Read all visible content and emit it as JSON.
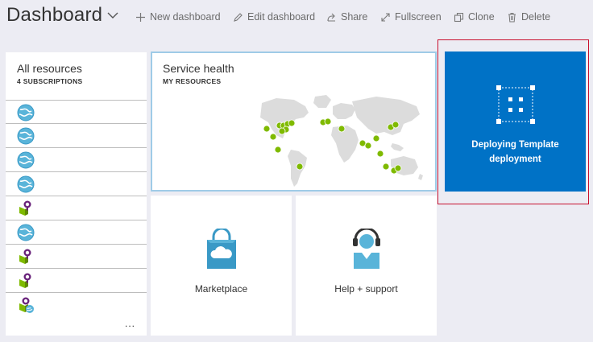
{
  "header": {
    "title": "Dashboard",
    "actions": [
      {
        "label": "New dashboard",
        "icon": "plus-icon"
      },
      {
        "label": "Edit dashboard",
        "icon": "pencil-icon"
      },
      {
        "label": "Share",
        "icon": "share-icon"
      },
      {
        "label": "Fullscreen",
        "icon": "fullscreen-icon"
      },
      {
        "label": "Clone",
        "icon": "clone-icon"
      },
      {
        "label": "Delete",
        "icon": "trash-icon"
      }
    ]
  },
  "tiles": {
    "resources": {
      "title": "All resources",
      "subtitle": "4 SUBSCRIPTIONS",
      "items": [
        {
          "icon": "web-app-globe-icon"
        },
        {
          "icon": "web-app-globe-icon"
        },
        {
          "icon": "web-app-globe-icon"
        },
        {
          "icon": "web-app-globe-icon"
        },
        {
          "icon": "app-insights-bulb-icon"
        },
        {
          "icon": "web-app-globe-icon"
        },
        {
          "icon": "app-insights-bulb-icon"
        },
        {
          "icon": "app-insights-bulb-icon"
        },
        {
          "icon": "app-insights-bulb-globe-icon"
        }
      ],
      "more": "..."
    },
    "health": {
      "title": "Service health",
      "subtitle": "MY RESOURCES"
    },
    "marketplace": {
      "label": "Marketplace"
    },
    "help": {
      "label": "Help + support"
    },
    "deploy": {
      "line1": "Deploying Template",
      "line2": "deployment"
    }
  },
  "colors": {
    "background": "#ececf3",
    "deploy_tile": "#0072c6",
    "health_ok": "#7fba00",
    "highlight_frame": "#c8102e",
    "map_land": "#dcdcdc"
  }
}
